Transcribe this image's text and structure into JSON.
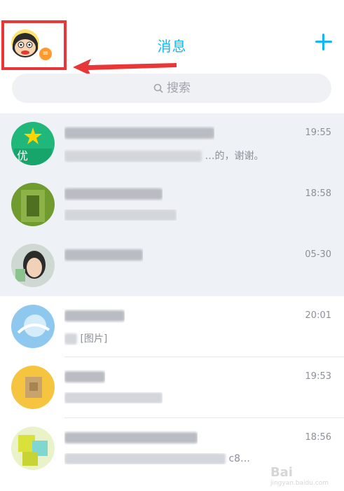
{
  "header": {
    "title": "消息",
    "add_icon": "plus-icon"
  },
  "search": {
    "placeholder": "搜索",
    "icon": "search-icon"
  },
  "conversations": [
    {
      "time": "19:55",
      "msg_visible": "…的，谢谢。",
      "pinned": true
    },
    {
      "time": "18:58",
      "pinned": true
    },
    {
      "time": "05-30",
      "pinned": true
    },
    {
      "time": "20:01",
      "msg_visible": "[图片]",
      "pinned": false
    },
    {
      "time": "19:53",
      "pinned": false
    },
    {
      "time": "18:56",
      "msg_visible": "c8…",
      "pinned": false
    }
  ],
  "colors": {
    "accent": "#12b7f5",
    "highlight": "#e93636",
    "pinned_bg": "#eef1f5"
  },
  "watermark": {
    "brand": "Bai",
    "sub": "jingyan.baidu.com"
  }
}
